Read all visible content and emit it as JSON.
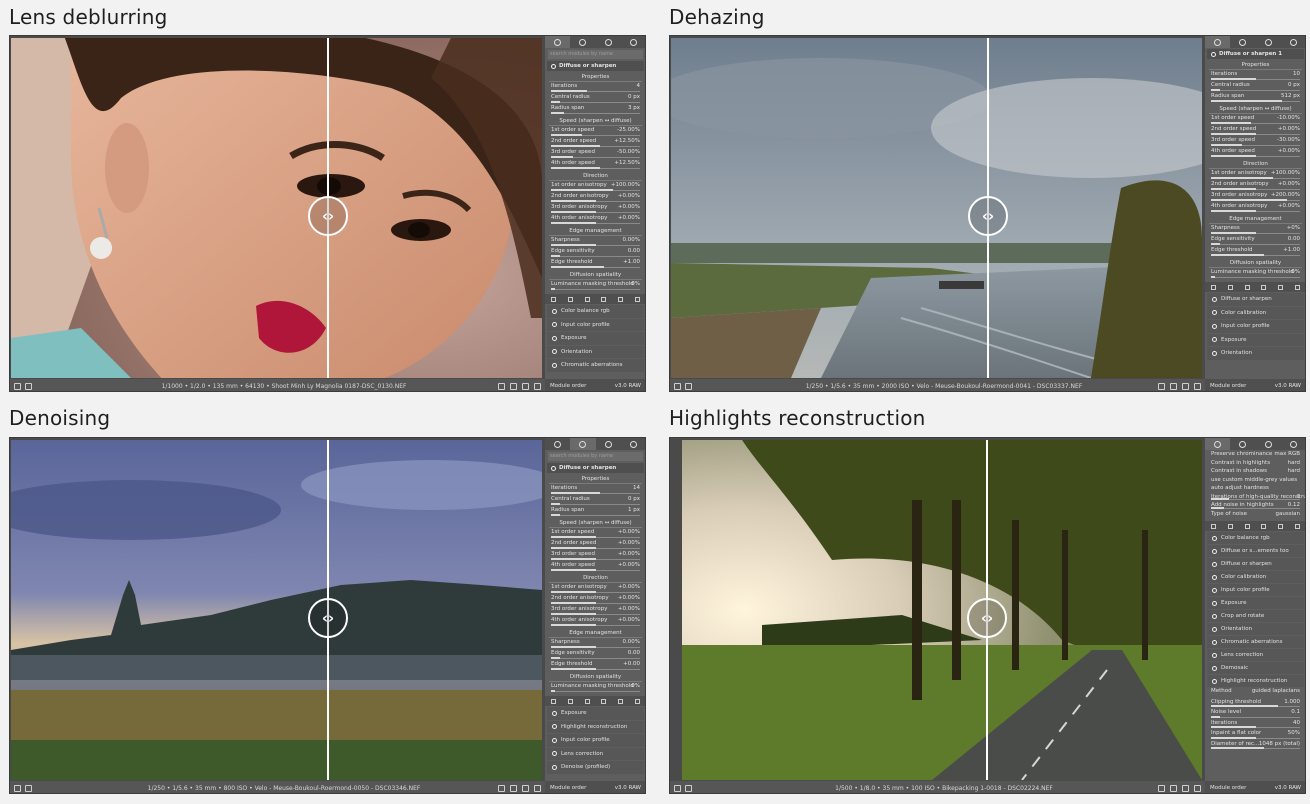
{
  "panels": [
    {
      "title": "Lens deblurring",
      "status": "1/1000 • 1/2.0 • 135 mm • 64130 • Shoot Minh Ly Magnolia 0187-DSC_0130.NEF",
      "search": "search modules by name",
      "module": "Diffuse or sharpen",
      "sections": [
        {
          "title": "Properties",
          "rows": [
            {
              "label": "Iterations",
              "value": "4",
              "level": 0.4
            },
            {
              "label": "Central radius",
              "value": "0 px",
              "level": 0.1
            },
            {
              "label": "Radius span",
              "value": "3 px",
              "level": 0.15
            }
          ]
        },
        {
          "title": "Speed (sharpen ↔ diffuse)",
          "rows": [
            {
              "label": "1st order speed",
              "value": "-25.00%",
              "level": 0.35
            },
            {
              "label": "2nd order speed",
              "value": "+12.50%",
              "level": 0.55
            },
            {
              "label": "3rd order speed",
              "value": "-50.00%",
              "level": 0.25
            },
            {
              "label": "4th order speed",
              "value": "+12.50%",
              "level": 0.55
            }
          ]
        },
        {
          "title": "Direction",
          "rows": [
            {
              "label": "1st order anisotropy",
              "value": "+100.00%",
              "level": 0.7
            },
            {
              "label": "2nd order anisotropy",
              "value": "+0.00%",
              "level": 0.5
            },
            {
              "label": "3rd order anisotropy",
              "value": "+0.00%",
              "level": 0.5
            },
            {
              "label": "4th order anisotropy",
              "value": "+0.00%",
              "level": 0.5
            }
          ]
        },
        {
          "title": "Edge management",
          "rows": [
            {
              "label": "Sharpness",
              "value": "0.00%",
              "level": 0.5
            },
            {
              "label": "Edge sensitivity",
              "value": "0.00",
              "level": 0.1
            },
            {
              "label": "Edge threshold",
              "value": "+1.00",
              "level": 0.6
            }
          ]
        },
        {
          "title": "Diffusion spatiality",
          "rows": [
            {
              "label": "Luminance masking threshold",
              "value": "0%",
              "level": 0.05
            }
          ]
        }
      ],
      "modules": [
        "Color balance rgb",
        "Input color profile",
        "Exposure",
        "Orientation",
        "Chromatic aberrations"
      ],
      "footer_left": "Module order",
      "footer_right": "v3.0 RAW"
    },
    {
      "title": "Dehazing",
      "status": "1/250 • 1/5.6 • 35 mm • 2000 ISO • Velo - Meuse-Boukoul-Roermond-0041 - DSC03337.NEF",
      "search": "",
      "module": "Diffuse or sharpen 1",
      "sections": [
        {
          "title": "Properties",
          "rows": [
            {
              "label": "Iterations",
              "value": "10",
              "level": 0.5
            },
            {
              "label": "Central radius",
              "value": "0 px",
              "level": 0.1
            },
            {
              "label": "Radius span",
              "value": "512 px",
              "level": 0.8
            }
          ]
        },
        {
          "title": "Speed (sharpen ↔ diffuse)",
          "rows": [
            {
              "label": "1st order speed",
              "value": "-10.00%",
              "level": 0.45
            },
            {
              "label": "2nd order speed",
              "value": "+0.00%",
              "level": 0.5
            },
            {
              "label": "3rd order speed",
              "value": "-30.00%",
              "level": 0.35
            },
            {
              "label": "4th order speed",
              "value": "+0.00%",
              "level": 0.5
            }
          ]
        },
        {
          "title": "Direction",
          "rows": [
            {
              "label": "1st order anisotropy",
              "value": "+100.00%",
              "level": 0.7
            },
            {
              "label": "2nd order anisotropy",
              "value": "+0.00%",
              "level": 0.5
            },
            {
              "label": "3rd order anisotropy",
              "value": "+200.00%",
              "level": 0.85
            },
            {
              "label": "4th order anisotropy",
              "value": "+0.00%",
              "level": 0.5
            }
          ]
        },
        {
          "title": "Edge management",
          "rows": [
            {
              "label": "Sharpness",
              "value": "+0%",
              "level": 0.5
            },
            {
              "label": "Edge sensitivity",
              "value": "0.00",
              "level": 0.1
            },
            {
              "label": "Edge threshold",
              "value": "+1.00",
              "level": 0.6
            }
          ]
        },
        {
          "title": "Diffusion spatiality",
          "rows": [
            {
              "label": "Luminance masking threshold",
              "value": "0%",
              "level": 0.05
            }
          ]
        }
      ],
      "modules": [
        "Diffuse or sharpen",
        "Color calibration",
        "Input color profile",
        "Exposure",
        "Orientation"
      ],
      "footer_left": "Module order",
      "footer_right": "v3.0 RAW"
    },
    {
      "title": "Denoising",
      "status": "1/250 • 1/5.6 • 35 mm • 800 ISO • Velo - Meuse-Boukoul-Roermond-0050 - DSC03346.NEF",
      "search": "search modules by name",
      "module": "Diffuse or sharpen",
      "sections": [
        {
          "title": "Properties",
          "rows": [
            {
              "label": "Iterations",
              "value": "14",
              "level": 0.55
            },
            {
              "label": "Central radius",
              "value": "0 px",
              "level": 0.1
            },
            {
              "label": "Radius span",
              "value": "1 px",
              "level": 0.1
            }
          ]
        },
        {
          "title": "Speed (sharpen ↔ diffuse)",
          "rows": [
            {
              "label": "1st order speed",
              "value": "+0.00%",
              "level": 0.5
            },
            {
              "label": "2nd order speed",
              "value": "+0.00%",
              "level": 0.5
            },
            {
              "label": "3rd order speed",
              "value": "+0.00%",
              "level": 0.5
            },
            {
              "label": "4th order speed",
              "value": "+0.00%",
              "level": 0.5
            }
          ]
        },
        {
          "title": "Direction",
          "rows": [
            {
              "label": "1st order anisotropy",
              "value": "+0.00%",
              "level": 0.5
            },
            {
              "label": "2nd order anisotropy",
              "value": "+0.00%",
              "level": 0.5
            },
            {
              "label": "3rd order anisotropy",
              "value": "+0.00%",
              "level": 0.5
            },
            {
              "label": "4th order anisotropy",
              "value": "+0.00%",
              "level": 0.5
            }
          ]
        },
        {
          "title": "Edge management",
          "rows": [
            {
              "label": "Sharpness",
              "value": "0.00%",
              "level": 0.5
            },
            {
              "label": "Edge sensitivity",
              "value": "0.00",
              "level": 0.1
            },
            {
              "label": "Edge threshold",
              "value": "+0.00",
              "level": 0.5
            }
          ]
        },
        {
          "title": "Diffusion spatiality",
          "rows": [
            {
              "label": "Luminance masking threshold",
              "value": "0%",
              "level": 0.05
            }
          ]
        }
      ],
      "modules": [
        "Exposure",
        "Highlight reconstruction",
        "Input color profile",
        "Lens correction",
        "Denoise (profiled)"
      ],
      "footer_left": "Module order",
      "footer_right": "v3.0 RAW"
    },
    {
      "title": "Highlights reconstruction",
      "status": "1/500 • 1/8.0 • 35 mm • 100 ISO • Bikepacking 1-0018 - DSC02224.NEF",
      "search": "",
      "module": "Color balance rgb",
      "sections": [
        {
          "title": "",
          "rows": [
            {
              "label": "Preserve chrominance",
              "value": "max RGB",
              "level": 0.0
            },
            {
              "label": "Contrast in highlights",
              "value": "hard",
              "level": 0.0
            },
            {
              "label": "Contrast in shadows",
              "value": "hard",
              "level": 0.0
            },
            {
              "label": "use custom middle-grey values",
              "value": "",
              "level": 0.0
            },
            {
              "label": "auto adjust hardness",
              "value": "",
              "level": 0.0
            },
            {
              "label": "Iterations of high-quality reconstruction",
              "value": "1",
              "level": 0.2
            },
            {
              "label": "Add noise in highlights",
              "value": "0.12",
              "level": 0.15
            },
            {
              "label": "Type of noise",
              "value": "gaussian",
              "level": 0.0
            }
          ]
        }
      ],
      "modules": [
        "Color balance rgb",
        "Diffuse or s...ements too",
        "Diffuse or sharpen",
        "Color calibration",
        "Input color profile",
        "Exposure",
        "Crop and rotate",
        "Orientation",
        "Chromatic aberrations",
        "Lens correction",
        "Demosaic",
        "Highlight reconstruction"
      ],
      "sub_rows": [
        {
          "label": "Method",
          "value": "guided laplacians",
          "level": 0.0
        },
        {
          "label": "Clipping threshold",
          "value": "1.000",
          "level": 0.75
        },
        {
          "label": "Noise level",
          "value": "0.1",
          "level": 0.1
        },
        {
          "label": "Iterations",
          "value": "40",
          "level": 0.5
        },
        {
          "label": "Inpaint a flat color",
          "value": "50%",
          "level": 0.5
        },
        {
          "label": "Diameter of rec...",
          "value": "1048 px (total)",
          "level": 0.6
        }
      ],
      "footer_left": "Module order",
      "footer_right": "v3.0 RAW"
    }
  ],
  "colors": {
    "title_text": "#1f1f1f",
    "ui_panel": "#5e5e5e",
    "ui_dark": "#4f4f4f",
    "split_line": "#ffffff"
  },
  "icons": [
    "compare-handle-icon",
    "power-icon",
    "reset-icon",
    "preset-icon",
    "module-tab-icon"
  ]
}
